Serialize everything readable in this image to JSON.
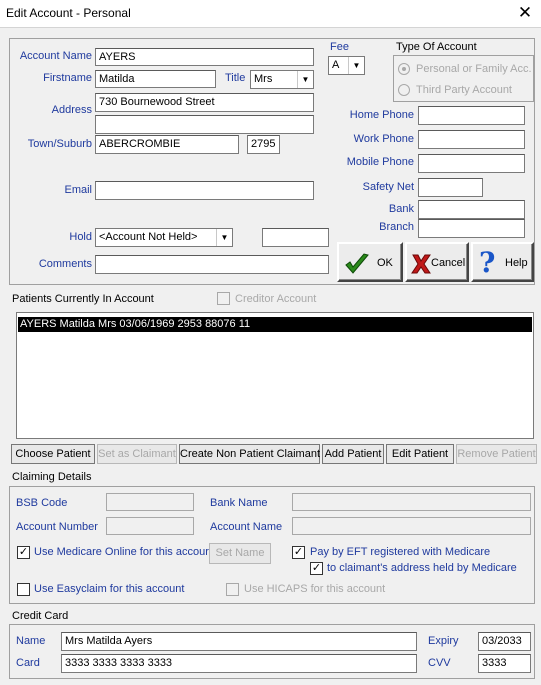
{
  "window": {
    "title": "Edit Account - Personal",
    "close_glyph": "✕"
  },
  "account": {
    "account_name_label": "Account Name",
    "account_name": "AYERS",
    "firstname_label": "Firstname",
    "firstname": "Matilda",
    "title_label": "Title",
    "title_value": "Mrs",
    "address_label": "Address",
    "address1": "730 Bournewood Street",
    "address2": "",
    "town_label": "Town/Suburb",
    "town": "ABERCROMBIE",
    "postcode": "2795",
    "email_label": "Email",
    "email": "",
    "hold_label": "Hold",
    "hold_value": "<Account Not Held>",
    "hold_extra": "",
    "comments_label": "Comments",
    "comments": ""
  },
  "fee": {
    "label": "Fee",
    "value": "A"
  },
  "type_of_account": {
    "label": "Type Of Account",
    "option1": "Personal or Family Acc.",
    "option2": "Third Party Account"
  },
  "phones": {
    "home_label": "Home Phone",
    "home": "",
    "work_label": "Work Phone",
    "work": "",
    "mobile_label": "Mobile Phone",
    "mobile": "",
    "safety_label": "Safety Net",
    "safety": "",
    "bank_label": "Bank",
    "bank": "",
    "branch_label": "Branch",
    "branch": ""
  },
  "actions": {
    "ok": "OK",
    "cancel": "Cancel",
    "help": "Help"
  },
  "patients": {
    "label": "Patients Currently In Account",
    "creditor_label": "Creditor Account",
    "rows": [
      "AYERS Matilda Mrs 03/06/1969 2953 88076 11"
    ]
  },
  "patient_buttons": {
    "choose": "Choose Patient",
    "set_claimant": "Set as Claimant",
    "create_non": "Create Non Patient Claimant",
    "add": "Add Patient",
    "edit": "Edit Patient",
    "remove": "Remove Patient"
  },
  "claiming": {
    "label": "Claiming Details",
    "bsb_label": "BSB Code",
    "bsb": "",
    "bank_name_label": "Bank Name",
    "bank_name": "",
    "acct_no_label": "Account Number",
    "acct_no": "",
    "acct_name_label": "Account Name",
    "acct_name": "",
    "medicare_online": "Use Medicare Online for this accour",
    "set_name": "Set Name",
    "pay_eft": "Pay by EFT registered with Medicare",
    "to_claimant": "to claimant's address held by Medicare",
    "easyclaim": "Use Easyclaim for this account",
    "hicaps": "Use HICAPS for this account"
  },
  "credit_card": {
    "label": "Credit Card",
    "name_label": "Name",
    "name": "Mrs Matilda Ayers",
    "card_label": "Card",
    "card": "3333 3333 3333 3333",
    "expiry_label": "Expiry",
    "expiry": "03/2033",
    "cvv_label": "CVV",
    "cvv": "3333"
  },
  "colors": {
    "label_blue": "#1f3a9e",
    "ok_green": "#2a8a1a",
    "cancel_red": "#c01818",
    "help_blue": "#1a56c8"
  }
}
